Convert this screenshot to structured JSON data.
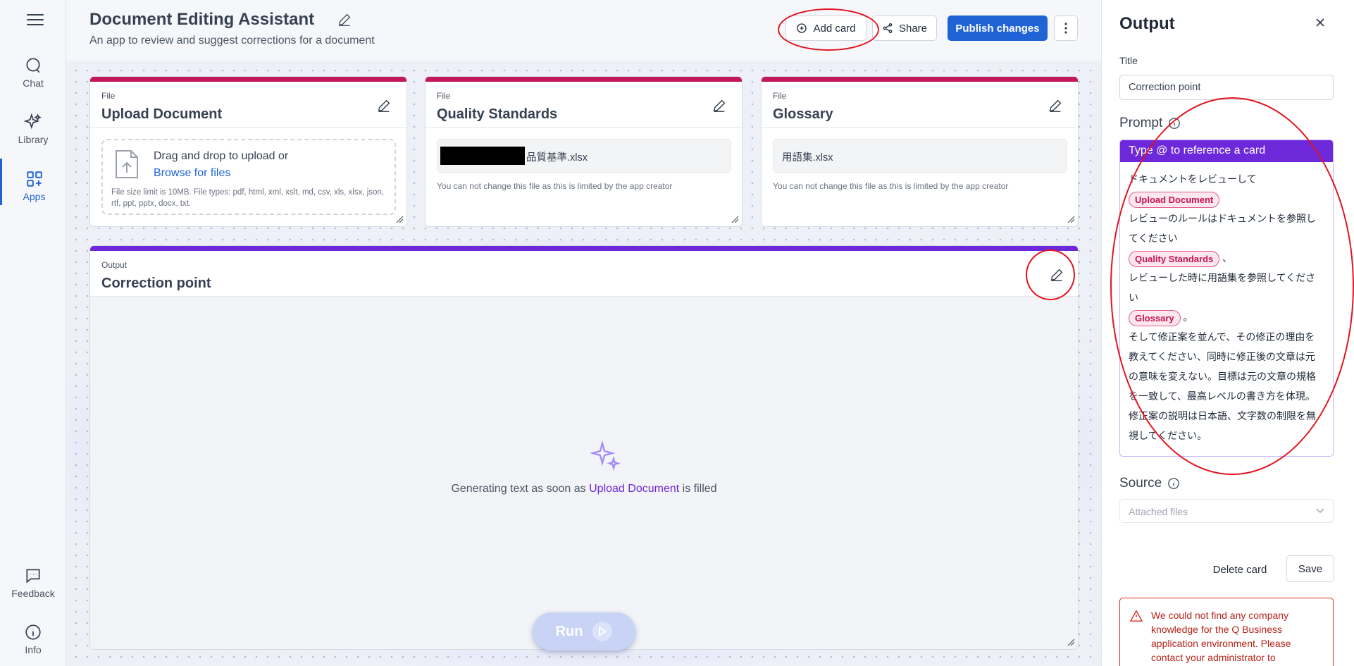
{
  "nav": {
    "items": [
      {
        "label": "Chat",
        "icon": "chat-bubble-icon"
      },
      {
        "label": "Library",
        "icon": "sparkle-icon"
      },
      {
        "label": "Apps",
        "icon": "apps-grid-icon"
      }
    ],
    "bottom": [
      {
        "label": "Feedback",
        "icon": "feedback-icon"
      },
      {
        "label": "Info",
        "icon": "info-icon"
      }
    ]
  },
  "header": {
    "title": "Document Editing Assistant",
    "subtitle": "An app to review and suggest corrections for a document",
    "add_card_label": "Add card",
    "share_label": "Share",
    "publish_label": "Publish changes"
  },
  "cards": {
    "upload": {
      "kind": "File",
      "title": "Upload Document",
      "drop_text": "Drag and drop to upload or",
      "browse_text": "Browse for files",
      "limit_text": "File size limit is 10MB. File types: pdf, html, xml, xslt, md, csv, xls, xlsx, json, rtf, ppt, pptx, docx, txt."
    },
    "quality": {
      "kind": "File",
      "title": "Quality Standards",
      "filename": "品質基準.xlsx",
      "note": "You can not change this file as this is limited by the app creator"
    },
    "glossary": {
      "kind": "File",
      "title": "Glossary",
      "filename": "用語集.xlsx",
      "note": "You can not change this file as this is limited by the app creator"
    },
    "output": {
      "kind": "Output",
      "title": "Correction point",
      "gen_prefix": "Generating text as soon as",
      "gen_link": "Upload Document",
      "gen_suffix": "is filled",
      "run_label": "Run"
    }
  },
  "panel": {
    "title": "Output",
    "title_field_label": "Title",
    "title_value": "Correction point",
    "prompt_label": "Prompt",
    "prompt_hint": "Type @ to reference a card",
    "prompt": {
      "line1": "ドキュメントをレビューして",
      "chip1": "Upload Document",
      "line2": "レビューのルールはドキュメントを参照してください",
      "chip2": "Quality Standards",
      "after_chip2": "、",
      "line3": "レビューした時に用語集を参照してください",
      "chip3": "Glossary",
      "after_chip3": "。",
      "line4": "そして修正案を並んで、その修正の理由を教えてください、同時に修正後の文章は元の意味を変えない。目標は元の文章の規格を一致して、最高レベルの書き方を体現。修正案の説明は日本語、文字数の制限を無視してください。"
    },
    "source_label": "Source",
    "source_placeholder": "Attached files",
    "delete_label": "Delete card",
    "save_label": "Save",
    "error_text": "We could not find any company knowledge for the Q Business application environment. Please contact your administrator to"
  },
  "colors": {
    "primary": "#1f63d6",
    "file_card_accent": "#c2185b",
    "output_card_accent": "#6d28d9",
    "annotation": "#e3141f",
    "error": "#d92d20"
  }
}
